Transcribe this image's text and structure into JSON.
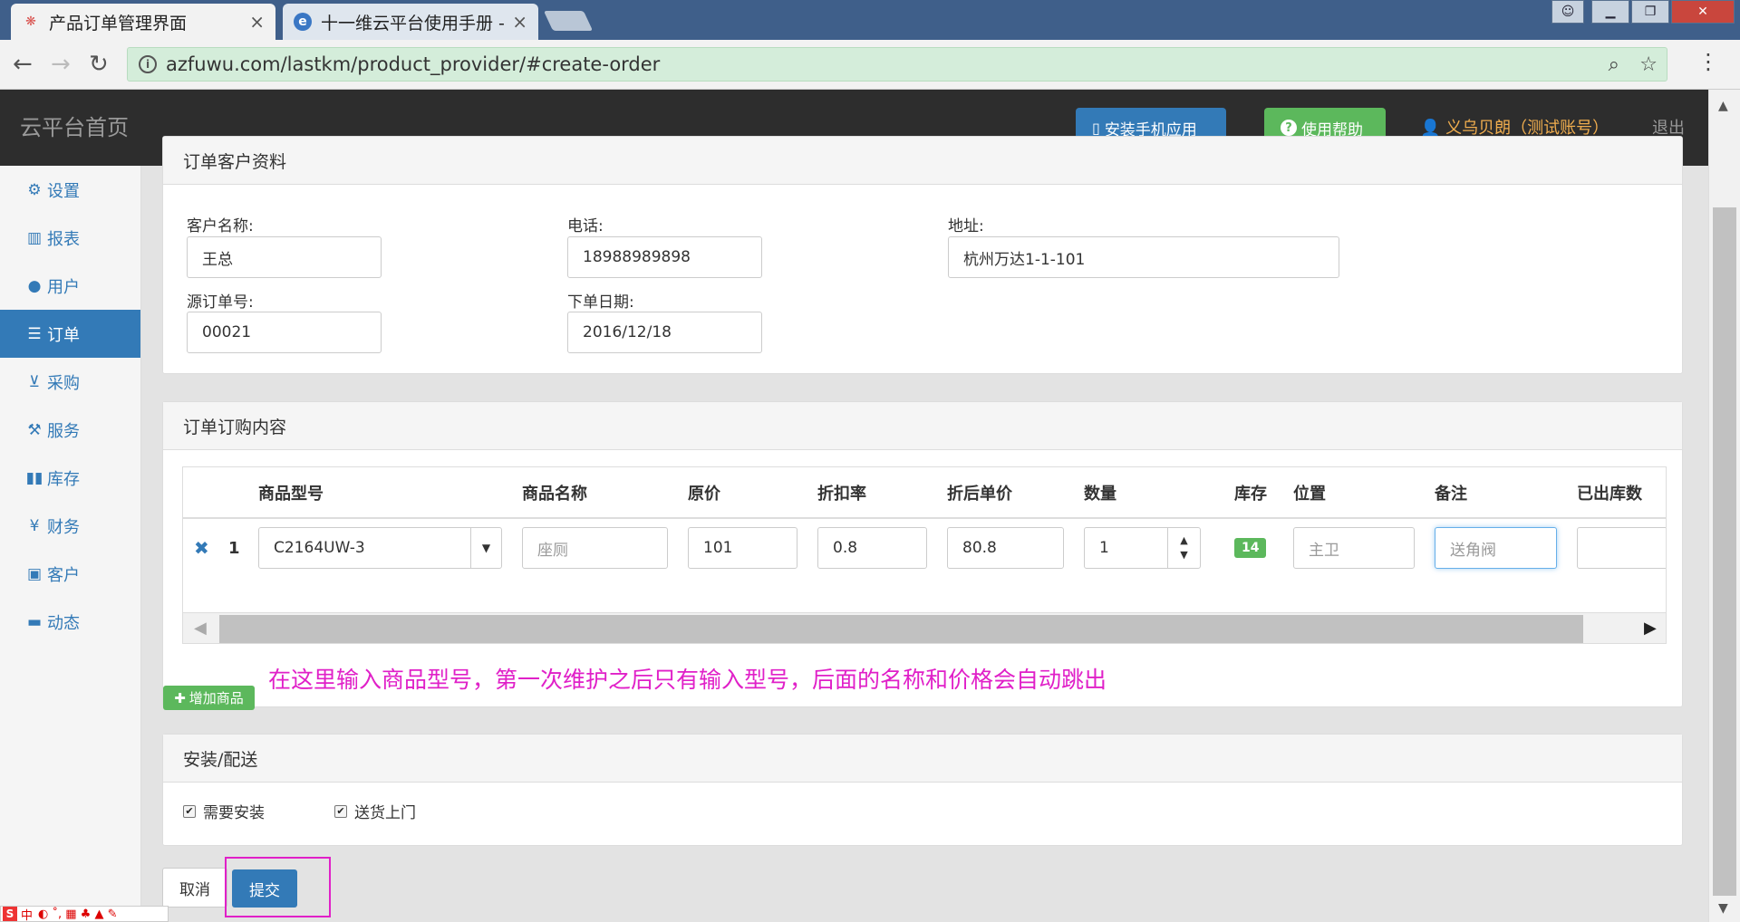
{
  "browser": {
    "tabs": [
      {
        "title": "产品订单管理界面",
        "close": "×",
        "active": true
      },
      {
        "title": "十一维云平台使用手册 -",
        "close": "×",
        "active": false
      }
    ],
    "url": "azfuwu.com/lastkm/product_provider/#create-order",
    "icons": [
      "back-icon",
      "forward-icon",
      "reload-icon",
      "info-icon",
      "zoom-icon",
      "star-icon",
      "menu-icon"
    ]
  },
  "header": {
    "brand": "云平台首页",
    "install_app": "安装手机应用",
    "help": "使用帮助",
    "user": "义乌贝朗（测试账号）",
    "logout": "退出"
  },
  "sidebar": {
    "items": [
      {
        "label": "设置",
        "icon": "gear-icon"
      },
      {
        "label": "报表",
        "icon": "bar-chart-icon"
      },
      {
        "label": "用户",
        "icon": "user-icon"
      },
      {
        "label": "订单",
        "icon": "list-icon",
        "active": true
      },
      {
        "label": "采购",
        "icon": "cart-icon"
      },
      {
        "label": "服务",
        "icon": "wrench-icon"
      },
      {
        "label": "库存",
        "icon": "barcode-icon"
      },
      {
        "label": "财务",
        "icon": "yen-icon"
      },
      {
        "label": "客户",
        "icon": "briefcase-icon"
      },
      {
        "label": "动态",
        "icon": "comment-icon"
      }
    ]
  },
  "customer": {
    "heading": "订单客户资料",
    "name_label": "客户名称:",
    "name_value": "王总",
    "phone_label": "电话:",
    "phone_value": "18988989898",
    "address_label": "地址:",
    "address_value": "杭州万达1-1-101",
    "source_label": "源订单号:",
    "source_value": "00021",
    "date_label": "下单日期:",
    "date_value": "2016/12/18"
  },
  "order": {
    "heading": "订单订购内容",
    "columns": [
      "商品型号",
      "商品名称",
      "原价",
      "折扣率",
      "折后单价",
      "数量",
      "库存",
      "位置",
      "备注",
      "已出库数"
    ],
    "row": {
      "remove": "✖",
      "index": "1",
      "model": "C2164UW-3",
      "name_placeholder": "座厕",
      "price": "101",
      "discount": "0.8",
      "discounted_price": "80.8",
      "quantity": "1",
      "stock": "14",
      "position_placeholder": "主卫",
      "remark_placeholder": "送角阀",
      "shipped": ""
    },
    "note": "在这里输入商品型号，第一次维护之后只有输入型号，后面的名称和价格会自动跳出",
    "add_button": "增加商品"
  },
  "delivery": {
    "heading": "安装/配送",
    "install_label": "需要安装",
    "install_checked": true,
    "delivery_label": "送货上门",
    "delivery_checked": true
  },
  "actions": {
    "cancel": "取消",
    "submit": "提交"
  },
  "ime": {
    "logo": "S",
    "mode": "中"
  }
}
